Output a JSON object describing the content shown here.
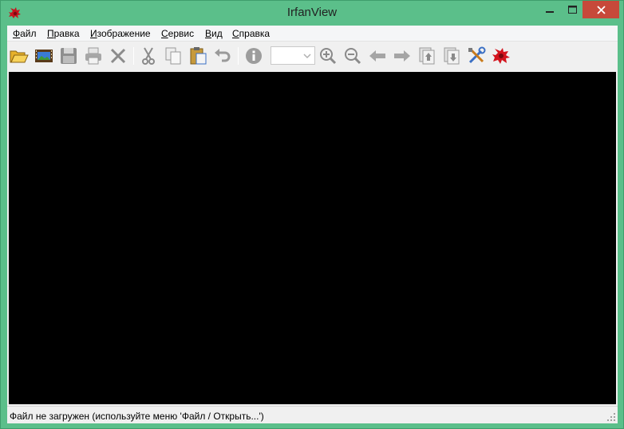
{
  "window": {
    "title": "IrfanView",
    "app_icon": "irfanview-red-cat-icon",
    "controls": {
      "minimize": "minimize-icon",
      "maximize": "maximize-icon",
      "close": "close-icon"
    }
  },
  "menubar": {
    "items": [
      {
        "ul": "Ф",
        "rest": "айл"
      },
      {
        "ul": "П",
        "rest": "равка"
      },
      {
        "ul": "И",
        "rest": "зображение"
      },
      {
        "ul": "С",
        "rest": "ервис"
      },
      {
        "ul": "В",
        "rest": "ид"
      },
      {
        "ul": "С",
        "rest": "правка"
      }
    ]
  },
  "toolbar": {
    "icons": [
      "open-folder-icon",
      "slideshow-icon",
      "save-icon",
      "print-icon",
      "delete-icon",
      "cut-icon",
      "copy-icon",
      "paste-icon",
      "undo-icon",
      "info-icon",
      "zoom-in-icon",
      "zoom-out-icon",
      "previous-icon",
      "next-icon",
      "first-page-icon",
      "last-page-icon",
      "settings-icon",
      "about-icon"
    ],
    "zoom_value": ""
  },
  "colors": {
    "frame": "#5bbf8a",
    "close_button": "#c7493a",
    "canvas": "#000000"
  },
  "statusbar": {
    "text": "Файл не загружен (используйте меню 'Файл / Открыть...')"
  }
}
